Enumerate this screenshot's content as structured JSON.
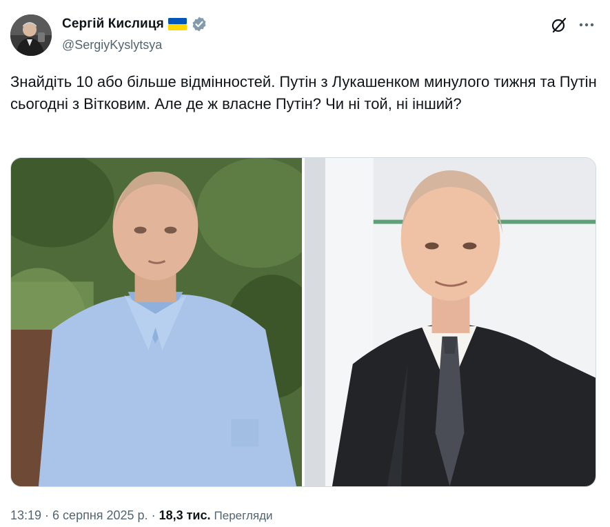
{
  "author": {
    "display_name": "Сергій Кислиця",
    "handle": "@SergiyKyslytsya",
    "flag_icon": "ukraine-flag-icon",
    "verified_icon": "verified-badge-icon",
    "verified_color": "#829aab"
  },
  "header_actions": {
    "grok_icon": "grok-icon",
    "more_icon": "more-icon"
  },
  "tweet": {
    "text": "Знайдіть 10 або більше відмінностей. Путін з Лукашенком минулого тижня та Путін сьогодні з Вітковим. Але де ж власне Путін? Чи ні той, ні інший?"
  },
  "media": {
    "photos": [
      {
        "label": "photo-left",
        "description_icon": "photo-man-blue-shirt-garden"
      },
      {
        "label": "photo-right",
        "description_icon": "photo-man-dark-suit-tie"
      }
    ]
  },
  "meta": {
    "time": "13:19",
    "separator": " · ",
    "date": "6 серпня 2025 р.",
    "views_count": "18,3 тис.",
    "views_label": "Перегляди"
  },
  "colors": {
    "text_primary": "#0f1419",
    "text_secondary": "#536471",
    "border": "#cfd9de",
    "flag_blue": "#0057b7",
    "flag_yellow": "#ffd700"
  }
}
